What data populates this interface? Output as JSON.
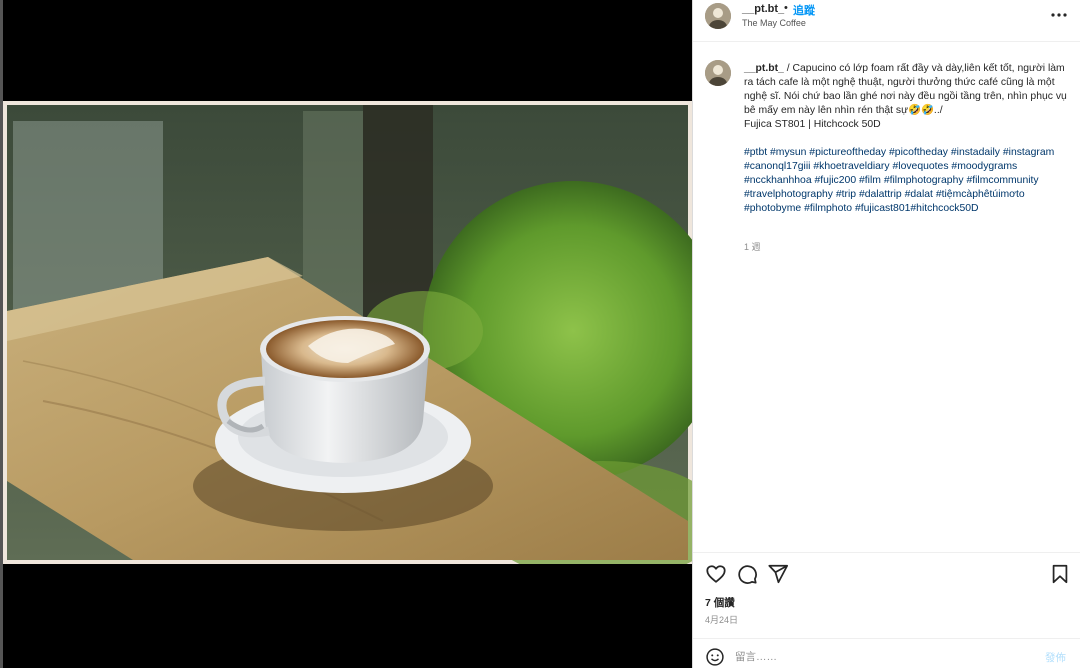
{
  "post": {
    "username": "__pt.bt_",
    "separator": "•",
    "follow_label": "追蹤",
    "location": "The May Coffee"
  },
  "caption": {
    "username": "__pt.bt_",
    "text_line": " / Capucino có lớp foam rất đầy và dày,liên kết tốt, người làm ra tách cafe là một nghệ thuật, người thưởng thức café cũng là một nghệ sĩ. Nói chứ bao lần ghé nơi này đều ngồi tầng trên, nhìn phục vụ bê mấy em này lên nhìn rén thật sự🤣🤣../",
    "camera_line": "Fujica ST801 | Hitchcock 50D",
    "hashtags": [
      "#ptbt",
      "#mysun",
      "#pictureoftheday",
      "#picoftheday",
      "#instadaily",
      "#instagram",
      "#canonql17giii",
      "#khoetraveldiary",
      "#lovequotes",
      "#moodygrams",
      "#ncckhanhhoa",
      "#fujic200",
      "#film",
      "#filmphotography",
      "#filmcommunity",
      "#travelphotography",
      "#trip",
      "#dalattrip",
      "#dalat",
      "#tiệmcàphêtúimơto",
      "#photobyme",
      "#filmphoto",
      "#fujicast801#hitchcock50D"
    ],
    "time_ago": "1 週"
  },
  "stats": {
    "likes": "7 個讚",
    "date": "4月24日"
  },
  "comment": {
    "placeholder": "留言……",
    "post_label": "發佈"
  },
  "icons": {
    "more": "more-options-icon",
    "like": "heart-icon",
    "comment": "comment-icon",
    "share": "share-icon",
    "save": "bookmark-icon",
    "emoji": "emoji-icon"
  },
  "colors": {
    "link": "#0095f6",
    "hashtag": "#00376b",
    "muted": "#8e8e8e",
    "post_button_disabled": "#b2dffc"
  }
}
